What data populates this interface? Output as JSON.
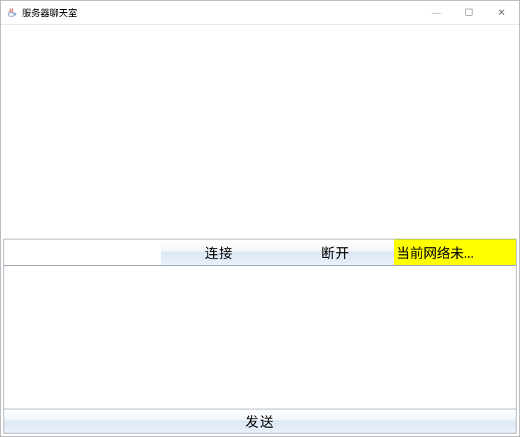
{
  "window": {
    "title": "服务器聊天室",
    "icon_name": "java-cup-icon"
  },
  "controls": {
    "minimize_symbol": "—",
    "maximize_symbol": "☐",
    "close_symbol": "✕"
  },
  "chat": {
    "log_text": "",
    "address_value": "",
    "connect_label": "连接",
    "disconnect_label": "断开",
    "status_text": "当前网络未...",
    "status_bg": "#ffff00",
    "message_value": "",
    "send_label": "发送"
  }
}
